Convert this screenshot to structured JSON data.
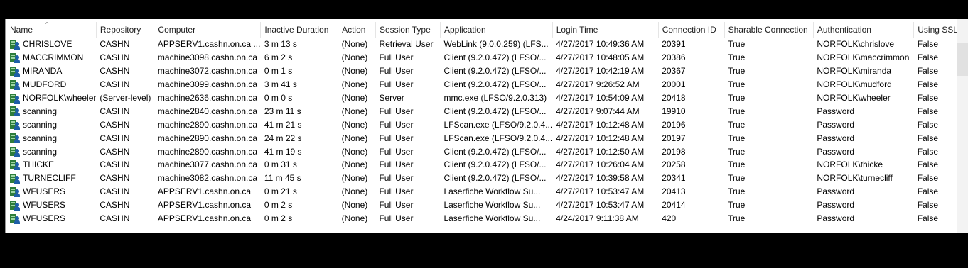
{
  "columns": [
    "Name",
    "Repository",
    "Computer",
    "Inactive Duration",
    "Action",
    "Session Type",
    "Application",
    "Login Time",
    "Connection ID",
    "Sharable Connection",
    "Authentication",
    "Using SSL"
  ],
  "sort_indicator": "^",
  "row_icon": "user-session-icon",
  "rows": [
    [
      "CHRISLOVE",
      "CASHN",
      "APPSERV1.cashn.on.ca ...",
      "3 m 13 s",
      "(None)",
      "Retrieval User",
      "WebLink (9.0.0.259) (LFS...",
      "4/27/2017 10:49:36 AM",
      "20391",
      "True",
      "NORFOLK\\chrislove",
      "False"
    ],
    [
      "MACCRIMMON",
      "CASHN",
      "machine3098.cashn.on.ca",
      "6 m 2 s",
      "(None)",
      "Full User",
      "Client (9.2.0.472) (LFSO/...",
      "4/27/2017 10:48:05 AM",
      "20386",
      "True",
      "NORFOLK\\maccrimmon",
      "False"
    ],
    [
      "MIRANDA",
      "CASHN",
      "machine3072.cashn.on.ca",
      "0 m 1 s",
      "(None)",
      "Full User",
      "Client (9.2.0.472) (LFSO/...",
      "4/27/2017 10:42:19 AM",
      "20367",
      "True",
      "NORFOLK\\miranda",
      "False"
    ],
    [
      "MUDFORD",
      "CASHN",
      "machine3099.cashn.on.ca",
      "3 m 41 s",
      "(None)",
      "Full User",
      "Client (9.2.0.472) (LFSO/...",
      "4/27/2017 9:26:52 AM",
      "20001",
      "True",
      "NORFOLK\\mudford",
      "False"
    ],
    [
      "NORFOLK\\wheeler",
      "(Server-level)",
      "machine2636.cashn.on.ca",
      "0 m 0 s",
      "(None)",
      "Server",
      "mmc.exe (LFSO/9.2.0.313)",
      "4/27/2017 10:54:09 AM",
      "20418",
      "True",
      "NORFOLK\\wheeler",
      "False"
    ],
    [
      "scanning",
      "CASHN",
      "machine2840.cashn.on.ca",
      "23 m 11 s",
      "(None)",
      "Full User",
      "Client (9.2.0.472) (LFSO/...",
      "4/27/2017 9:07:44 AM",
      "19910",
      "True",
      "Password",
      "False"
    ],
    [
      "scanning",
      "CASHN",
      "machine2890.cashn.on.ca",
      "41 m 21 s",
      "(None)",
      "Full User",
      "LFScan.exe (LFSO/9.2.0.4...",
      "4/27/2017 10:12:48 AM",
      "20196",
      "True",
      "Password",
      "False"
    ],
    [
      "scanning",
      "CASHN",
      "machine2890.cashn.on.ca",
      "24 m 22 s",
      "(None)",
      "Full User",
      "LFScan.exe (LFSO/9.2.0.4...",
      "4/27/2017 10:12:48 AM",
      "20197",
      "True",
      "Password",
      "False"
    ],
    [
      "scanning",
      "CASHN",
      "machine2890.cashn.on.ca",
      "41 m 19 s",
      "(None)",
      "Full User",
      "Client (9.2.0.472) (LFSO/...",
      "4/27/2017 10:12:50 AM",
      "20198",
      "True",
      "Password",
      "False"
    ],
    [
      "THICKE",
      "CASHN",
      "machine3077.cashn.on.ca",
      "0 m 31 s",
      "(None)",
      "Full User",
      "Client (9.2.0.472) (LFSO/...",
      "4/27/2017 10:26:04 AM",
      "20258",
      "True",
      "NORFOLK\\thicke",
      "False"
    ],
    [
      "TURNECLIFF",
      "CASHN",
      "machine3082.cashn.on.ca",
      "11 m 45 s",
      "(None)",
      "Full User",
      "Client (9.2.0.472) (LFSO/...",
      "4/27/2017 10:39:58 AM",
      "20341",
      "True",
      "NORFOLK\\turnecliff",
      "False"
    ],
    [
      "WFUSERS",
      "CASHN",
      "APPSERV1.cashn.on.ca",
      "0 m 21 s",
      "(None)",
      "Full User",
      "Laserfiche Workflow Su...",
      "4/27/2017 10:53:47 AM",
      "20413",
      "True",
      "Password",
      "False"
    ],
    [
      "WFUSERS",
      "CASHN",
      "APPSERV1.cashn.on.ca",
      "0 m 2 s",
      "(None)",
      "Full User",
      "Laserfiche Workflow Su...",
      "4/27/2017 10:53:47 AM",
      "20414",
      "True",
      "Password",
      "False"
    ],
    [
      "WFUSERS",
      "CASHN",
      "APPSERV1.cashn.on.ca",
      "0 m 2 s",
      "(None)",
      "Full User",
      "Laserfiche Workflow Su...",
      "4/24/2017 9:11:38 AM",
      "420",
      "True",
      "Password",
      "False"
    ]
  ]
}
